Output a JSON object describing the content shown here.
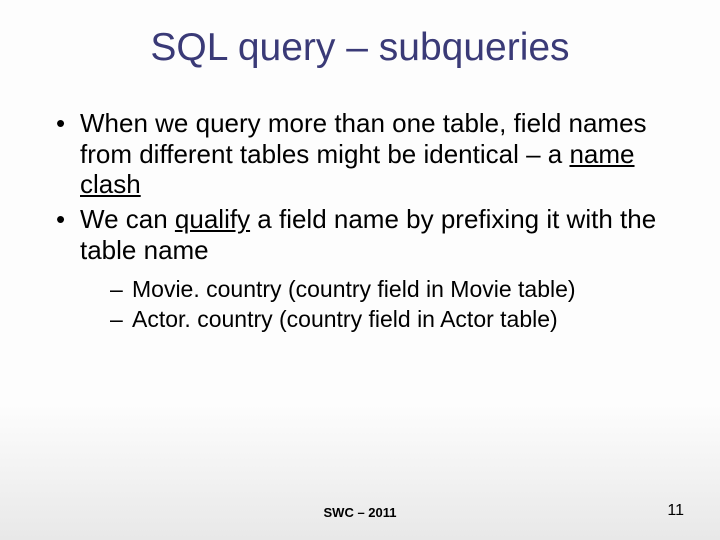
{
  "title": "SQL query – subqueries",
  "bullets": {
    "b1": {
      "pre": "When we query more than one table, field names from different tables might be identical – a ",
      "u": "name clash"
    },
    "b2": {
      "pre": "We can ",
      "u": "qualify",
      "post": " a field name by prefixing it with the table name"
    }
  },
  "subs": {
    "s1": "Movie. country (country field in Movie table)",
    "s2": "Actor. country (country field in Actor table)"
  },
  "footer": "SWC – 2011",
  "page": "11"
}
